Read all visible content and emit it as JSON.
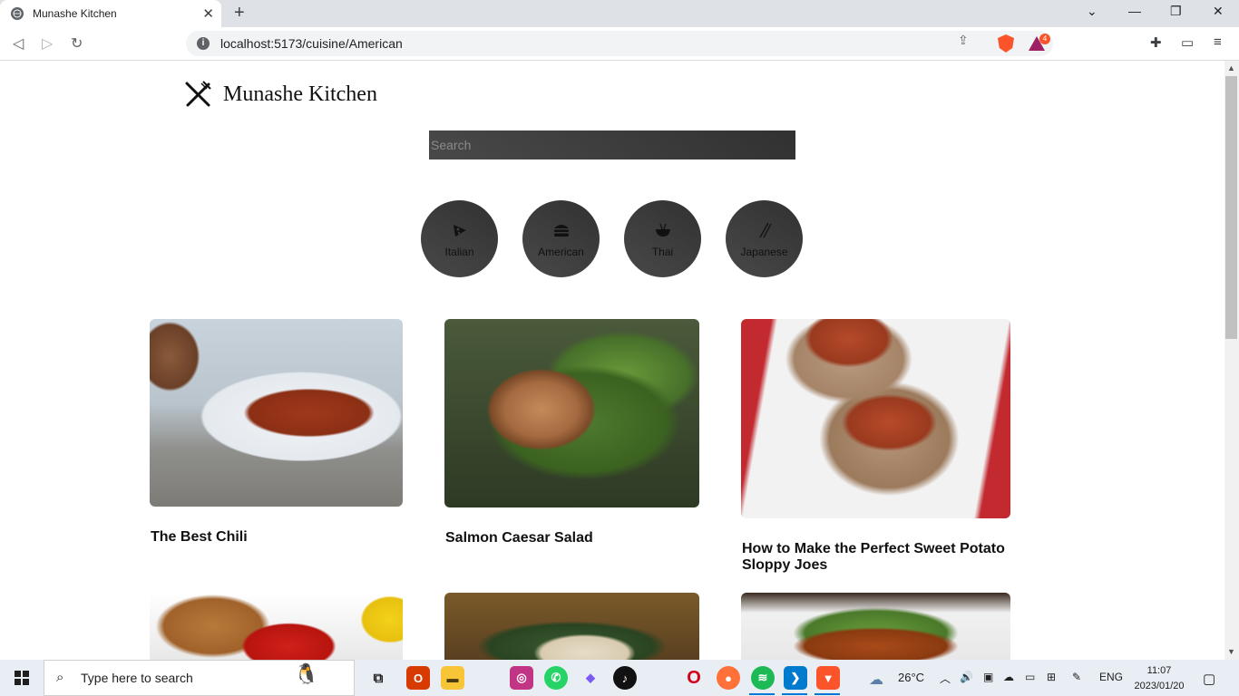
{
  "browser": {
    "tab_title": "Munashe Kitchen",
    "tab_close": "✕",
    "new_tab": "+",
    "url": "localhost:5173/cuisine/American",
    "rewards_count": "4"
  },
  "site": {
    "brand": "Munashe Kitchen",
    "search_placeholder": "Search"
  },
  "categories": [
    {
      "label": "Italian",
      "icon": "pizza-icon"
    },
    {
      "label": "American",
      "icon": "burger-icon"
    },
    {
      "label": "Thai",
      "icon": "noodle-bowl-icon"
    },
    {
      "label": "Japanese",
      "icon": "chopsticks-icon"
    }
  ],
  "recipes": [
    {
      "title": "The Best Chili"
    },
    {
      "title": "Salmon Caesar Salad"
    },
    {
      "title": "How to Make the Perfect Sweet Potato Sloppy Joes"
    }
  ],
  "taskbar": {
    "search_placeholder": "Type here to search",
    "temperature": "26°C",
    "language": "ENG",
    "time": "11:07",
    "date": "2023/01/20"
  },
  "colors": {
    "category_bg": "#3d3d3d",
    "search_bg": "#3d3d3d",
    "accent": "#0078d4"
  }
}
